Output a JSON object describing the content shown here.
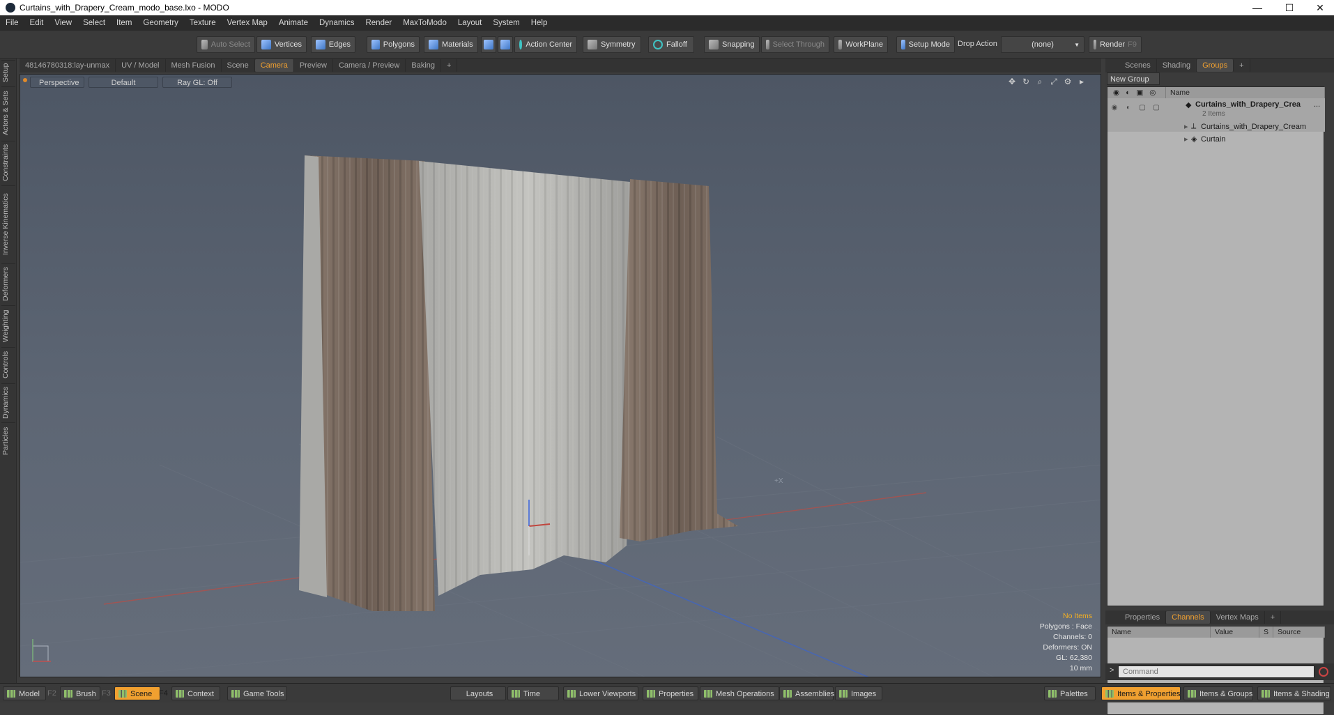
{
  "window": {
    "title": "Curtains_with_Drapery_Cream_modo_base.lxo - MODO",
    "minimize": "—",
    "maximize": "☐",
    "close": "✕"
  },
  "menu": [
    "File",
    "Edit",
    "View",
    "Select",
    "Item",
    "Geometry",
    "Texture",
    "Vertex Map",
    "Animate",
    "Dynamics",
    "Render",
    "MaxToModo",
    "Layout",
    "System",
    "Help"
  ],
  "toolbar": {
    "auto_select": "Auto Select",
    "vertices": "Vertices",
    "edges": "Edges",
    "polygons": "Polygons",
    "materials": "Materials",
    "action_center": "Action Center",
    "symmetry": "Symmetry",
    "falloff": "Falloff",
    "snapping": "Snapping",
    "select_through": "Select Through",
    "workplane": "WorkPlane",
    "setup_mode": "Setup Mode",
    "drop_action_label": "Drop Action",
    "drop_action_value": "(none)",
    "render": "Render",
    "render_key": "F9"
  },
  "viewport_tabs": [
    "48146780318:lay-unmax",
    "UV / Model",
    "Mesh Fusion",
    "Scene",
    "Camera",
    "Preview",
    "Camera / Preview",
    "Baking",
    "+"
  ],
  "viewport_active_tab": "Camera",
  "left_tabs": [
    "Setup",
    "Actors & Sets",
    "Constraints",
    "Inverse Kinematics",
    "Deformers",
    "Weighting",
    "Controls",
    "Dynamics",
    "Particles"
  ],
  "viewport": {
    "projection": "Perspective",
    "shading": "Default",
    "raygl": "Ray GL: Off",
    "axis_label": "+X",
    "info": {
      "items": "No Items",
      "polygons": "Polygons : Face",
      "channels": "Channels: 0",
      "deformers": "Deformers: ON",
      "gl": "GL: 62,380",
      "scale": "10 mm"
    }
  },
  "right_top_tabs": [
    "Scenes",
    "Shading",
    "Groups",
    "+"
  ],
  "right_top_active": "Groups",
  "groups": {
    "new_group": "New Group",
    "name_header": "Name",
    "root": "Curtains_with_Drapery_Crea",
    "root_more": "...",
    "root_count": "2 Items",
    "children": [
      "Curtains_with_Drapery_Cream",
      "Curtain"
    ]
  },
  "right_bottom_tabs": [
    "Properties",
    "Channels",
    "Vertex Maps",
    "+"
  ],
  "right_bottom_active": "Channels",
  "channels_headers": [
    "Name",
    "Value",
    "S",
    "Source"
  ],
  "command": {
    "prompt": ">",
    "placeholder": "Command"
  },
  "bottombar": {
    "model": "Model",
    "model_key": "F2",
    "brush": "Brush",
    "brush_key": "F3",
    "scene": "Scene",
    "scene_key": "F4",
    "context": "Context",
    "game_tools": "Game Tools",
    "layouts": "Layouts",
    "time": "Time",
    "lower_viewports": "Lower Viewports",
    "properties": "Properties",
    "mesh_operations": "Mesh Operations",
    "assemblies": "Assemblies",
    "images": "Images",
    "palettes": "Palettes",
    "items_properties": "Items & Properties",
    "items_groups": "Items & Groups",
    "items_shading": "Items & Shading"
  },
  "colors": {
    "accent": "#f0a030",
    "curtain_brown": "#7b6a5e",
    "curtain_cream": "#b9b9b5",
    "viewport_bg": "#5a6370"
  }
}
